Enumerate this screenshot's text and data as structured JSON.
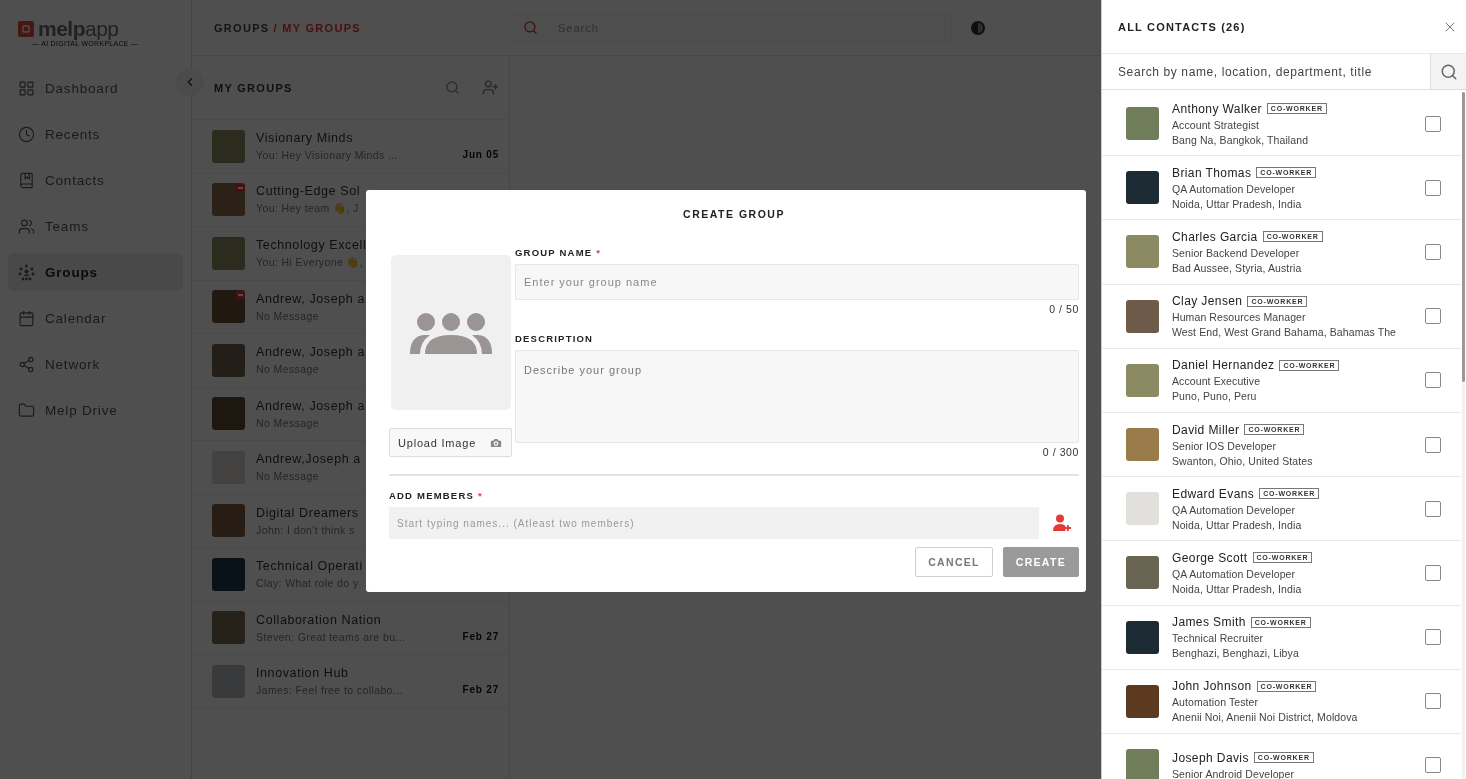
{
  "logo": {
    "text": "**melp**app",
    "tagline": "— AI DIGITAL WORKPLACE —"
  },
  "nav": [
    {
      "label": "Dashboard",
      "selected": false
    },
    {
      "label": "Recents",
      "selected": false
    },
    {
      "label": "Contacts",
      "selected": false
    },
    {
      "label": "Teams",
      "selected": false
    },
    {
      "label": "Groups",
      "selected": true
    },
    {
      "label": "Calendar",
      "selected": false
    },
    {
      "label": "Network",
      "selected": false
    },
    {
      "label": "Melp Drive",
      "selected": false
    }
  ],
  "header": {
    "breadcrumb": [
      {
        "label": "GROUPS",
        "selected": false
      },
      {
        "label": "/ MY GROUPS",
        "selected": true
      }
    ],
    "search": {
      "placeholder": "Search"
    }
  },
  "groups_panel": {
    "title": "MY GROUPS",
    "items": [
      {
        "name": "Visionary Minds",
        "preview": "You: Hey Visionary Minds ...",
        "date": "Jun 05",
        "badge": false
      },
      {
        "name": "Cutting-Edge Sol",
        "preview": "You: Hey team 👋, J",
        "badge": true
      },
      {
        "name": "Technology Excell",
        "preview": "You: Hi Everyone 👋,",
        "badge": false
      },
      {
        "name": "Andrew, Joseph a",
        "preview": "No Message",
        "badge": true
      },
      {
        "name": "Andrew, Joseph a",
        "preview": "No Message",
        "badge": false
      },
      {
        "name": "Andrew, Joseph a",
        "preview": "No Message",
        "badge": false
      },
      {
        "name": "Andrew,Joseph a",
        "preview": "No Message",
        "badge": false
      },
      {
        "name": "Digital Dreamers",
        "preview": "John: I don't think s",
        "badge": false
      },
      {
        "name": "Technical Operati",
        "preview": "Clay: What role do y",
        "badge": false
      },
      {
        "name": "Collaboration Nation",
        "preview": "Steven: Great teams are bu...",
        "date": "Feb 27",
        "badge": false
      },
      {
        "name": "Innovation Hub",
        "preview": "James: Feel free to collabo...",
        "date": "Feb 27",
        "badge": false
      }
    ]
  },
  "dialog": {
    "title": "CREATE GROUP",
    "upload_label": "Upload Image",
    "group_name": {
      "label": "GROUP NAME",
      "required_mark": "*",
      "placeholder": "Enter your group name",
      "counter": "0 / 50"
    },
    "description": {
      "label": "DESCRIPTION",
      "placeholder": "Describe your group",
      "counter": "0 / 300"
    },
    "members": {
      "label": "ADD MEMBERS",
      "required_mark": "*",
      "placeholder": "Start typing names... (Atleast two members)"
    },
    "buttons": [
      {
        "label": "CANCEL",
        "kind": "secondary"
      },
      {
        "label": "CREATE",
        "kind": "primary"
      }
    ]
  },
  "contacts_panel": {
    "title": "ALL CONTACTS (26)",
    "search": {
      "placeholder": "Search by name, location, department, title"
    },
    "contacts": [
      {
        "name": "Anthony Walker",
        "tag": "CO-WORKER",
        "role": "Account Strategist",
        "location": "Bang Na, Bangkok, Thailand",
        "checked": false
      },
      {
        "name": "Brian Thomas",
        "tag": "CO-WORKER",
        "role": "QA Automation Developer",
        "location": "Noida, Uttar Pradesh, India",
        "checked": false
      },
      {
        "name": "Charles Garcia",
        "tag": "CO-WORKER",
        "role": "Senior Backend Developer",
        "location": "Bad Aussee, Styria, Austria",
        "checked": false
      },
      {
        "name": "Clay Jensen",
        "tag": "CO-WORKER",
        "role": "Human Resources Manager",
        "location": "West End, West Grand Bahama, Bahamas The",
        "checked": false
      },
      {
        "name": "Daniel Hernandez",
        "tag": "CO-WORKER",
        "role": "Account Executive",
        "location": "Puno, Puno, Peru",
        "checked": false
      },
      {
        "name": "David Miller",
        "tag": "CO-WORKER",
        "role": "Senior IOS Developer",
        "location": "Swanton, Ohio, United States",
        "checked": false
      },
      {
        "name": "Edward Evans",
        "tag": "CO-WORKER",
        "role": "QA Automation Developer",
        "location": "Noida, Uttar Pradesh, India",
        "checked": false
      },
      {
        "name": "George Scott",
        "tag": "CO-WORKER",
        "role": "QA Automation Developer",
        "location": "Noida, Uttar Pradesh, India",
        "checked": false
      },
      {
        "name": "James Smith",
        "tag": "CO-WORKER",
        "role": "Technical Recruiter",
        "location": "Benghazi, Benghazi, Libya",
        "checked": false
      },
      {
        "name": "John Johnson",
        "tag": "CO-WORKER",
        "role": "Automation Tester",
        "location": "Anenii Noi, Anenii Noi District, Moldova",
        "checked": false
      },
      {
        "name": "Joseph Davis",
        "tag": "CO-WORKER",
        "role": "Senior Android Developer",
        "checked": false
      }
    ]
  }
}
